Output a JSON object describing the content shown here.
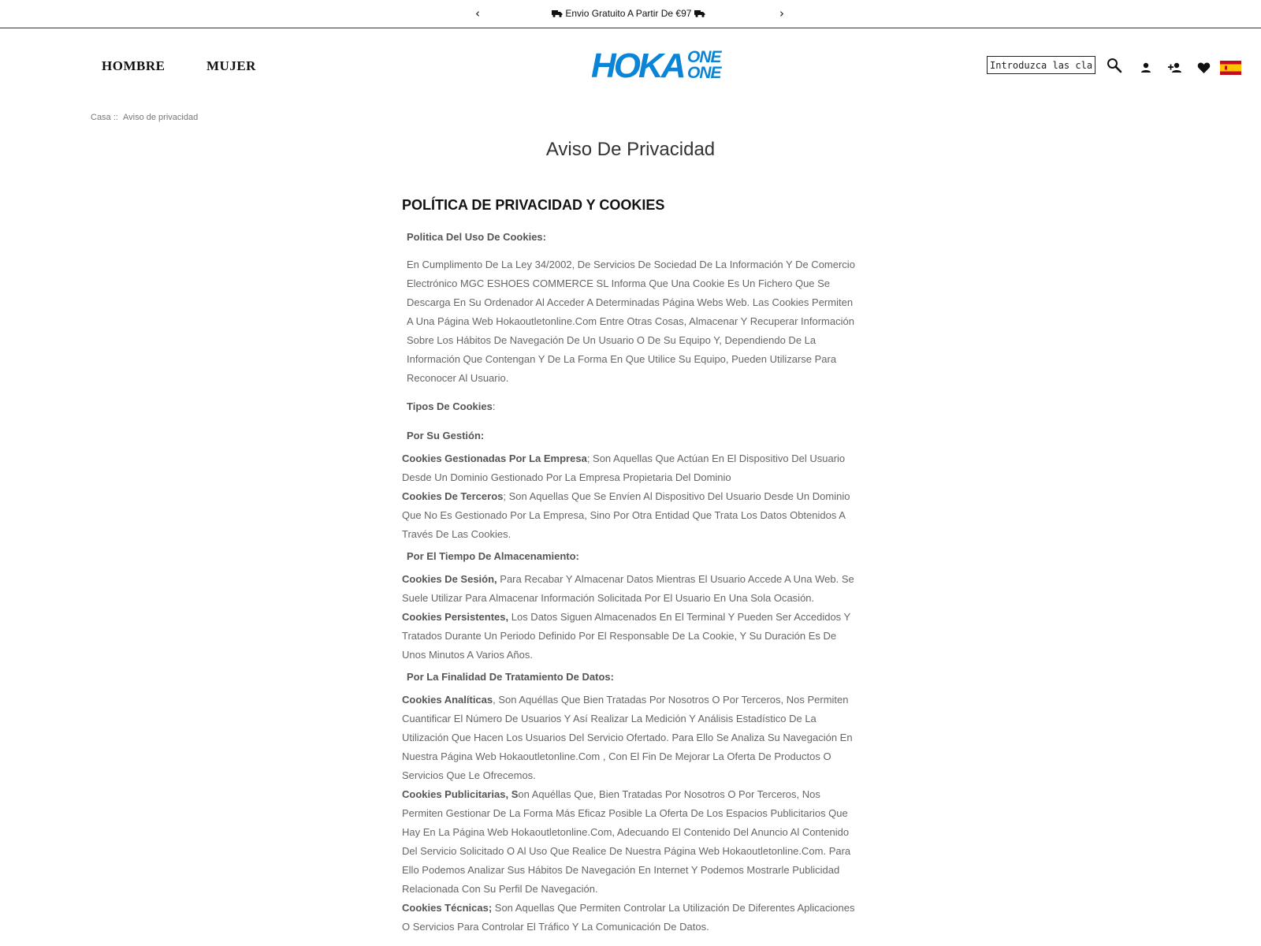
{
  "promo": {
    "prev": "‹",
    "next": "›",
    "text": "Envio Gratuito A Partir De €97"
  },
  "nav": {
    "men": "HOMBRE",
    "women": "MUJER"
  },
  "logo": {
    "line1": "HOKA",
    "line2a": "ONE",
    "line2b": "ONE"
  },
  "search": {
    "value": "Introduzca las claves d"
  },
  "header_icons": [
    "search-icon",
    "account-icon",
    "register-icon",
    "wishlist-icon",
    "spain-flag-icon"
  ],
  "colors": {
    "brand_blue": "#0a84d6",
    "flag_red": "#c60b1e",
    "flag_yellow": "#ffc400"
  },
  "breadcrumb": {
    "home": "Casa",
    "separator": "::",
    "current": "Aviso de privacidad"
  },
  "page_title": "Aviso De Privacidad",
  "policy": {
    "heading": "POLÍTICA DE PRIVACIDAD Y COOKIES",
    "usage_title": "Politica Del Uso De Cookies:",
    "intro": "En Cumplimento De La Ley 34/2002, De Servicios De Sociedad De La Información Y De Comercio Electrónico MGC ESHOES COMMERCE SL Informa Que Una Cookie Es Un Fichero Que Se Descarga En Su Ordenador Al Acceder A Determinadas Página Webs Web. Las Cookies Permiten A Una Página Web Hokaoutletonline.Com Entre Otras Cosas, Almacenar Y Recuperar Información Sobre Los Hábitos De Navegación De Un Usuario O De Su Equipo Y, Dependiendo De La Información Que Contengan Y De La Forma En Que Utilice Su Equipo, Pueden Utilizarse Para Reconocer Al Usuario.",
    "types_title": "Tipos De Cookies",
    "types_colon": ":",
    "management_title": "Por Su Gestión:",
    "own_term": "Cookies Gestionadas Por La Empresa",
    "own_desc": "; Son Aquellas Que Actúan En El Dispositivo Del Usuario Desde Un Dominio Gestionado Por La Empresa Propietaria Del Dominio",
    "third_term": "Cookies De Terceros",
    "third_desc": "; Son Aquellas Que Se Envíen Al Dispositivo Del Usuario Desde Un Dominio Que No Es Gestionado Por La Empresa, Sino Por Otra Entidad Que Trata Los Datos Obtenidos A Través De Las Cookies.",
    "storage_title": "Por El Tiempo De Almacenamiento:",
    "session_term": "Cookies De Sesión,",
    "session_desc": " Para Recabar Y Almacenar Datos Mientras El Usuario Accede A Una Web. Se Suele Utilizar Para Almacenar Información Solicitada Por El Usuario En Una Sola Ocasión.",
    "persistent_term": "Cookies Persistentes,",
    "persistent_desc": " Los Datos Siguen Almacenados En El Terminal Y Pueden Ser Accedidos Y Tratados Durante Un Periodo Definido Por El Responsable De La Cookie, Y Su Duración Es De Unos Minutos A Varios Años.",
    "purpose_title": "Por La Finalidad De Tratamiento De Datos:",
    "analytics_term": "Cookies Analíticas",
    "analytics_desc": ", Son Aquéllas Que Bien Tratadas Por Nosotros O Por Terceros, Nos Permiten Cuantificar El Número De Usuarios Y Así Realizar La Medición Y Análisis Estadístico De La Utilización Que Hacen Los Usuarios Del Servicio Ofertado. Para Ello Se Analiza Su Navegación En Nuestra Página Web Hokaoutletonline.Com , Con El Fin De Mejorar La Oferta De Productos O Servicios Que Le Ofrecemos.",
    "ads_term": "Cookies Publicitarias, S",
    "ads_desc": "on Aquéllas Que, Bien Tratadas Por Nosotros O Por Terceros, Nos Permiten Gestionar De La Forma Más Eficaz Posible La Oferta De Los Espacios Publicitarios Que Hay En La Página Web Hokaoutletonline.Com, Adecuando El Contenido Del Anuncio Al Contenido Del Servicio Solicitado O Al Uso Que Realice De Nuestra Página Web Hokaoutletonline.Com. Para Ello Podemos Analizar Sus Hábitos De Navegación En Internet Y Podemos Mostrarle Publicidad Relacionada Con Su Perfil De Navegación.",
    "technical_term": "Cookies Técnicas;",
    "technical_desc": " Son Aquellas Que Permiten Controlar La Utilización De Diferentes Aplicaciones O Servicios Para Controlar El Tráfico Y La Comunicación De Datos."
  }
}
